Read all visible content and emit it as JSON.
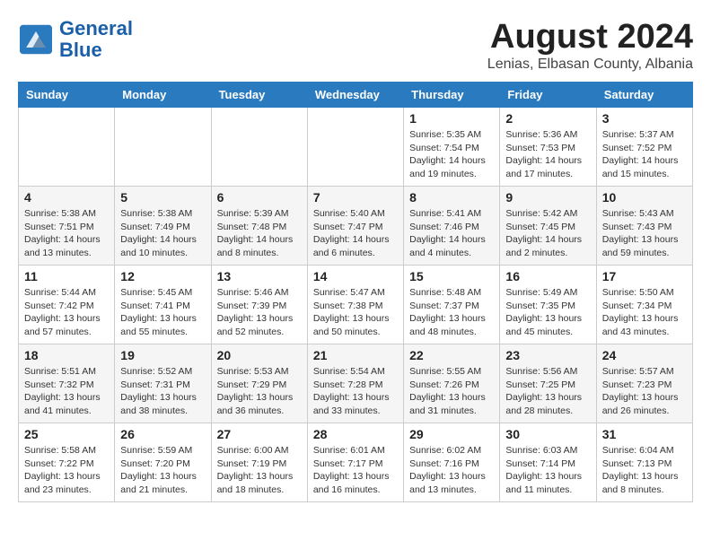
{
  "header": {
    "logo_line1": "General",
    "logo_line2": "Blue",
    "month": "August 2024",
    "location": "Lenias, Elbasan County, Albania"
  },
  "weekdays": [
    "Sunday",
    "Monday",
    "Tuesday",
    "Wednesday",
    "Thursday",
    "Friday",
    "Saturday"
  ],
  "weeks": [
    [
      {
        "day": "",
        "info": ""
      },
      {
        "day": "",
        "info": ""
      },
      {
        "day": "",
        "info": ""
      },
      {
        "day": "",
        "info": ""
      },
      {
        "day": "1",
        "info": "Sunrise: 5:35 AM\nSunset: 7:54 PM\nDaylight: 14 hours\nand 19 minutes."
      },
      {
        "day": "2",
        "info": "Sunrise: 5:36 AM\nSunset: 7:53 PM\nDaylight: 14 hours\nand 17 minutes."
      },
      {
        "day": "3",
        "info": "Sunrise: 5:37 AM\nSunset: 7:52 PM\nDaylight: 14 hours\nand 15 minutes."
      }
    ],
    [
      {
        "day": "4",
        "info": "Sunrise: 5:38 AM\nSunset: 7:51 PM\nDaylight: 14 hours\nand 13 minutes."
      },
      {
        "day": "5",
        "info": "Sunrise: 5:38 AM\nSunset: 7:49 PM\nDaylight: 14 hours\nand 10 minutes."
      },
      {
        "day": "6",
        "info": "Sunrise: 5:39 AM\nSunset: 7:48 PM\nDaylight: 14 hours\nand 8 minutes."
      },
      {
        "day": "7",
        "info": "Sunrise: 5:40 AM\nSunset: 7:47 PM\nDaylight: 14 hours\nand 6 minutes."
      },
      {
        "day": "8",
        "info": "Sunrise: 5:41 AM\nSunset: 7:46 PM\nDaylight: 14 hours\nand 4 minutes."
      },
      {
        "day": "9",
        "info": "Sunrise: 5:42 AM\nSunset: 7:45 PM\nDaylight: 14 hours\nand 2 minutes."
      },
      {
        "day": "10",
        "info": "Sunrise: 5:43 AM\nSunset: 7:43 PM\nDaylight: 13 hours\nand 59 minutes."
      }
    ],
    [
      {
        "day": "11",
        "info": "Sunrise: 5:44 AM\nSunset: 7:42 PM\nDaylight: 13 hours\nand 57 minutes."
      },
      {
        "day": "12",
        "info": "Sunrise: 5:45 AM\nSunset: 7:41 PM\nDaylight: 13 hours\nand 55 minutes."
      },
      {
        "day": "13",
        "info": "Sunrise: 5:46 AM\nSunset: 7:39 PM\nDaylight: 13 hours\nand 52 minutes."
      },
      {
        "day": "14",
        "info": "Sunrise: 5:47 AM\nSunset: 7:38 PM\nDaylight: 13 hours\nand 50 minutes."
      },
      {
        "day": "15",
        "info": "Sunrise: 5:48 AM\nSunset: 7:37 PM\nDaylight: 13 hours\nand 48 minutes."
      },
      {
        "day": "16",
        "info": "Sunrise: 5:49 AM\nSunset: 7:35 PM\nDaylight: 13 hours\nand 45 minutes."
      },
      {
        "day": "17",
        "info": "Sunrise: 5:50 AM\nSunset: 7:34 PM\nDaylight: 13 hours\nand 43 minutes."
      }
    ],
    [
      {
        "day": "18",
        "info": "Sunrise: 5:51 AM\nSunset: 7:32 PM\nDaylight: 13 hours\nand 41 minutes."
      },
      {
        "day": "19",
        "info": "Sunrise: 5:52 AM\nSunset: 7:31 PM\nDaylight: 13 hours\nand 38 minutes."
      },
      {
        "day": "20",
        "info": "Sunrise: 5:53 AM\nSunset: 7:29 PM\nDaylight: 13 hours\nand 36 minutes."
      },
      {
        "day": "21",
        "info": "Sunrise: 5:54 AM\nSunset: 7:28 PM\nDaylight: 13 hours\nand 33 minutes."
      },
      {
        "day": "22",
        "info": "Sunrise: 5:55 AM\nSunset: 7:26 PM\nDaylight: 13 hours\nand 31 minutes."
      },
      {
        "day": "23",
        "info": "Sunrise: 5:56 AM\nSunset: 7:25 PM\nDaylight: 13 hours\nand 28 minutes."
      },
      {
        "day": "24",
        "info": "Sunrise: 5:57 AM\nSunset: 7:23 PM\nDaylight: 13 hours\nand 26 minutes."
      }
    ],
    [
      {
        "day": "25",
        "info": "Sunrise: 5:58 AM\nSunset: 7:22 PM\nDaylight: 13 hours\nand 23 minutes."
      },
      {
        "day": "26",
        "info": "Sunrise: 5:59 AM\nSunset: 7:20 PM\nDaylight: 13 hours\nand 21 minutes."
      },
      {
        "day": "27",
        "info": "Sunrise: 6:00 AM\nSunset: 7:19 PM\nDaylight: 13 hours\nand 18 minutes."
      },
      {
        "day": "28",
        "info": "Sunrise: 6:01 AM\nSunset: 7:17 PM\nDaylight: 13 hours\nand 16 minutes."
      },
      {
        "day": "29",
        "info": "Sunrise: 6:02 AM\nSunset: 7:16 PM\nDaylight: 13 hours\nand 13 minutes."
      },
      {
        "day": "30",
        "info": "Sunrise: 6:03 AM\nSunset: 7:14 PM\nDaylight: 13 hours\nand 11 minutes."
      },
      {
        "day": "31",
        "info": "Sunrise: 6:04 AM\nSunset: 7:13 PM\nDaylight: 13 hours\nand 8 minutes."
      }
    ]
  ]
}
